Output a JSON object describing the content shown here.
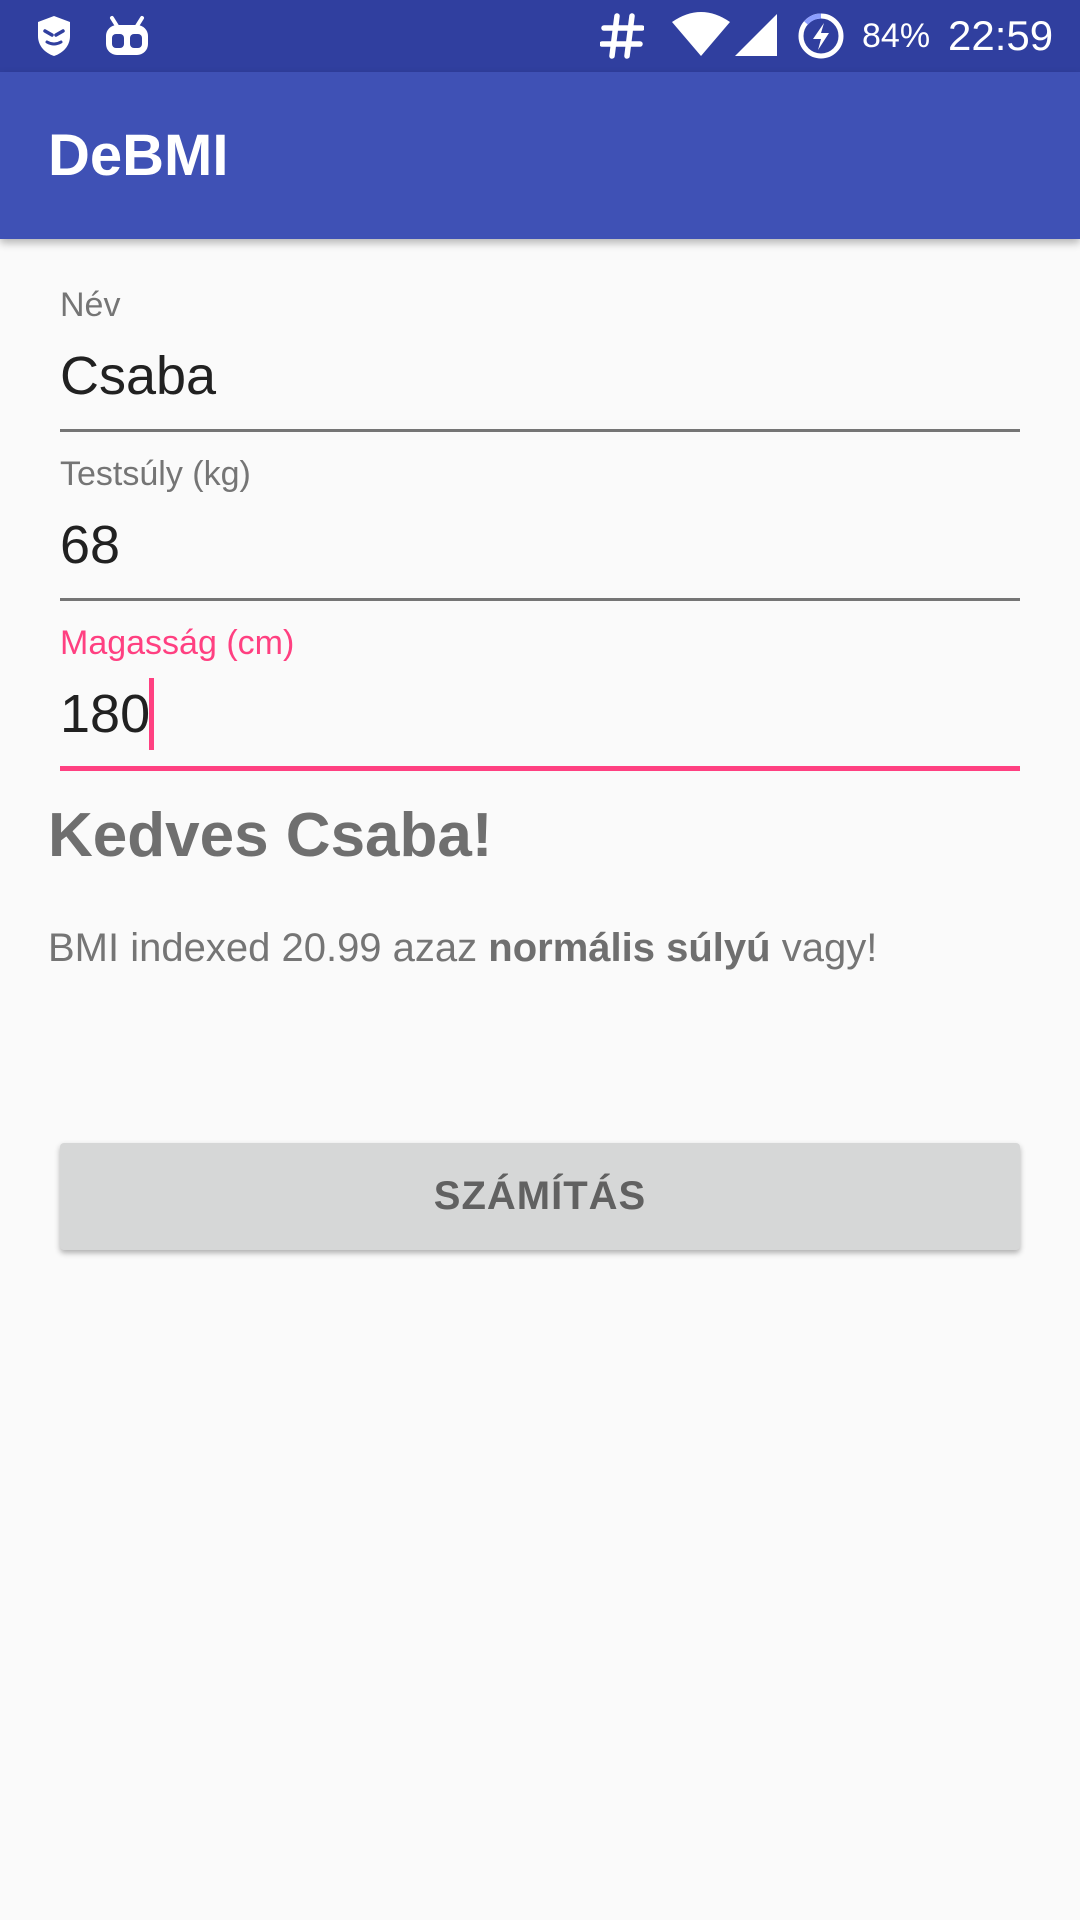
{
  "status_bar": {
    "icons": [
      "shield-icon",
      "android-icon",
      "hash-icon",
      "wifi-icon",
      "cell-signal-icon",
      "battery-charging-icon"
    ],
    "battery_percent": "84%",
    "clock": "22:59",
    "background_color": "#303F9F"
  },
  "app_bar": {
    "title": "DeBMI",
    "background_color": "#3F51B5"
  },
  "form": {
    "name_field": {
      "label": "Név",
      "value": "Csaba"
    },
    "weight_field": {
      "label": "Testsúly (kg)",
      "value": "68"
    },
    "height_field": {
      "label": "Magasság (cm)",
      "value": "180",
      "focused": true
    }
  },
  "result": {
    "greeting": "Kedves Csaba!",
    "bmi_prefix": "BMI indexed 20.99 azaz ",
    "bmi_category": "normális súlyú",
    "bmi_suffix": " vagy!"
  },
  "actions": {
    "calculate_label": "SZÁMÍTÁS"
  },
  "colors": {
    "accent": "#FF4081",
    "primary": "#3F51B5",
    "primary_dark": "#303F9F",
    "background": "#FAFAFA",
    "button": "#D6D7D7"
  }
}
